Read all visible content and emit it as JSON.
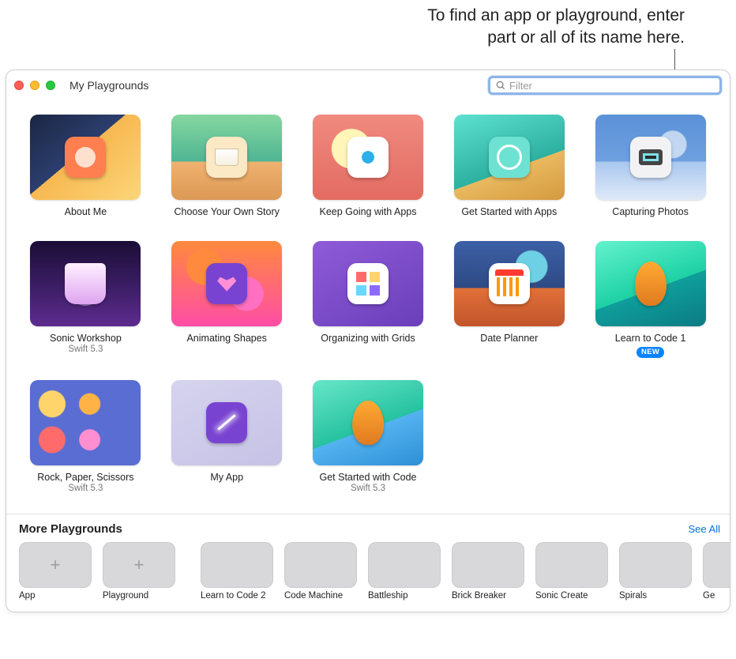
{
  "annotation": {
    "line1": "To find an app or playground, enter",
    "line2": "part or all of its name here."
  },
  "toolbar": {
    "title": "My Playgrounds",
    "search_placeholder": "Filter"
  },
  "badge_new_label": "NEW",
  "tiles": [
    {
      "title": "About Me",
      "subtitle": "",
      "thumb": "bg-aboutme",
      "icon": "contact",
      "new": false
    },
    {
      "title": "Choose Your Own Story",
      "subtitle": "",
      "thumb": "bg-story",
      "icon": "book",
      "new": false
    },
    {
      "title": "Keep Going with Apps",
      "subtitle": "",
      "thumb": "bg-keep",
      "icon": "peacock",
      "new": false
    },
    {
      "title": "Get Started with Apps",
      "subtitle": "",
      "thumb": "bg-getapps",
      "icon": "ideas",
      "new": false
    },
    {
      "title": "Capturing Photos",
      "subtitle": "",
      "thumb": "bg-capture",
      "icon": "camera",
      "new": false
    },
    {
      "title": "Sonic Workshop",
      "subtitle": "Swift 5.3",
      "thumb": "bg-sonic",
      "icon": "gem",
      "new": false
    },
    {
      "title": "Animating Shapes",
      "subtitle": "",
      "thumb": "bg-shapes",
      "icon": "heart",
      "new": false
    },
    {
      "title": "Organizing with Grids",
      "subtitle": "",
      "thumb": "bg-grids",
      "icon": "grid4",
      "new": false
    },
    {
      "title": "Date Planner",
      "subtitle": "",
      "thumb": "bg-date",
      "icon": "calendar",
      "new": false
    },
    {
      "title": "Learn to Code 1",
      "subtitle": "",
      "thumb": "bg-learn1",
      "icon": "byte",
      "new": true
    },
    {
      "title": "Rock, Paper, Scissors",
      "subtitle": "Swift 5.3",
      "thumb": "bg-rock",
      "icon": "",
      "new": false
    },
    {
      "title": "My App",
      "subtitle": "",
      "thumb": "bg-myapp",
      "icon": "wand",
      "new": false
    },
    {
      "title": "Get Started with Code",
      "subtitle": "Swift 5.3",
      "thumb": "bg-getcode",
      "icon": "byte",
      "new": false
    }
  ],
  "more": {
    "heading": "More Playgrounds",
    "see_all": "See All",
    "create": [
      {
        "label": "App"
      },
      {
        "label": "Playground"
      }
    ],
    "items": [
      {
        "label": "Learn to Code 2",
        "thumb": "mbg-learn2"
      },
      {
        "label": "Code Machine",
        "thumb": "mbg-codem"
      },
      {
        "label": "Battleship",
        "thumb": "mbg-battle"
      },
      {
        "label": "Brick Breaker",
        "thumb": "mbg-brick"
      },
      {
        "label": "Sonic Create",
        "thumb": "mbg-sonicc"
      },
      {
        "label": "Spirals",
        "thumb": "mbg-spiral"
      },
      {
        "label": "Ge",
        "thumb": "mbg-cut"
      }
    ]
  }
}
